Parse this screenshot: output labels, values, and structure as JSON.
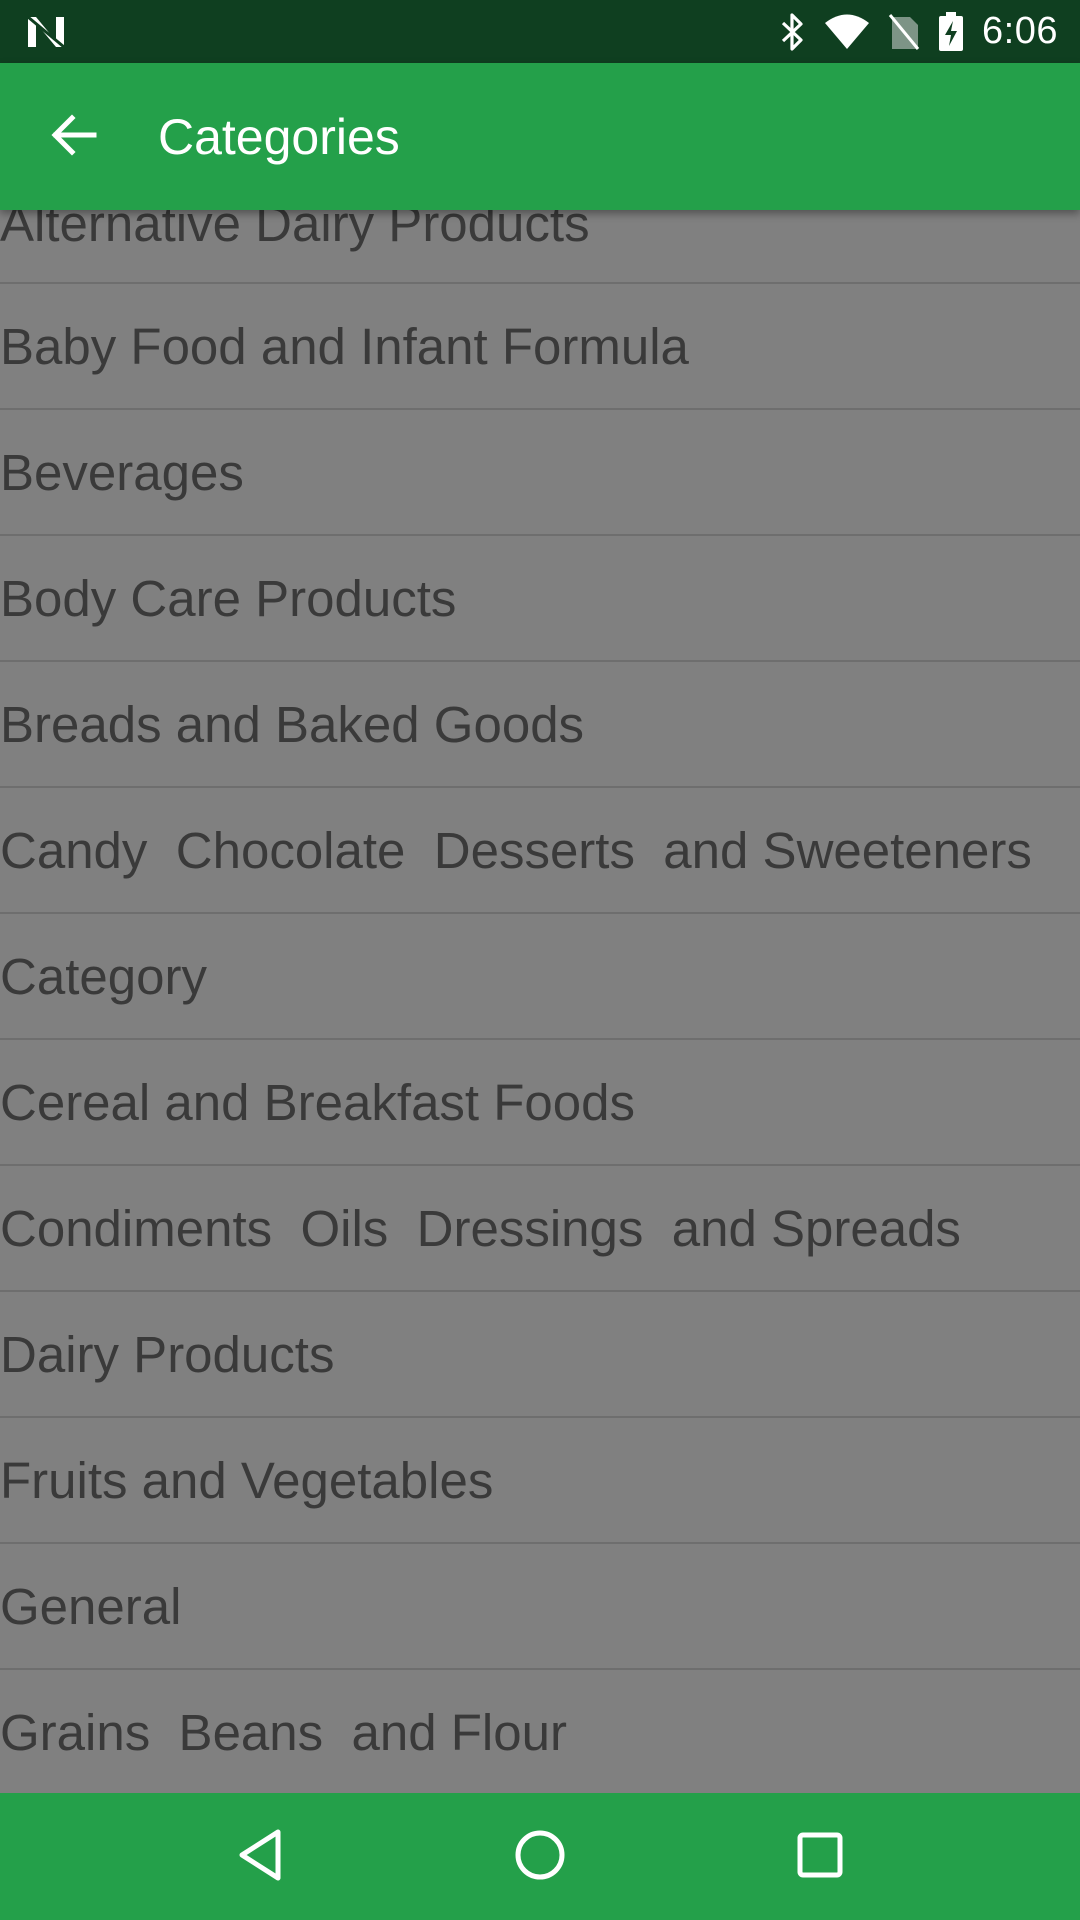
{
  "status_bar": {
    "time": "6:06",
    "icons": [
      "notification-n-icon",
      "bluetooth-icon",
      "wifi-icon",
      "no-sim-icon",
      "battery-charging-icon"
    ]
  },
  "app_bar": {
    "title": "Categories",
    "back_icon": "arrow-back-icon"
  },
  "categories": [
    "Alternative Dairy Products",
    "Baby Food and Infant Formula",
    "Beverages",
    "Body Care Products",
    "Breads and Baked Goods",
    "Candy  Chocolate  Desserts  and Sweeteners",
    "Category",
    "Cereal and Breakfast Foods",
    "Condiments  Oils  Dressings  and Spreads",
    "Dairy Products",
    "Fruits and Vegetables",
    "General",
    "Grains  Beans  and Flour"
  ],
  "nav_bar": {
    "buttons": [
      "back-triangle-icon",
      "home-circle-icon",
      "recents-square-icon"
    ]
  },
  "colors": {
    "status_bar": "#0f3f20",
    "app_bar": "#24a04a",
    "list_background": "#808080",
    "list_text": "#3a3a3a",
    "divider": "#6e6e6e"
  }
}
